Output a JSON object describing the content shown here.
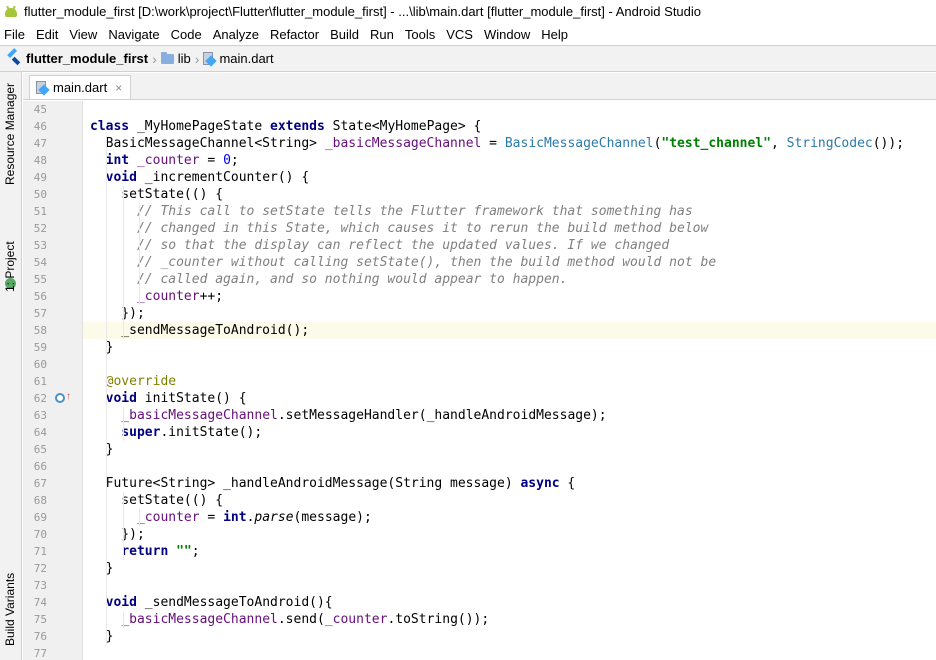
{
  "window": {
    "title": "flutter_module_first [D:\\work\\project\\Flutter\\flutter_module_first] - ...\\lib\\main.dart [flutter_module_first] - Android Studio"
  },
  "menu": [
    "File",
    "Edit",
    "View",
    "Navigate",
    "Code",
    "Analyze",
    "Refactor",
    "Build",
    "Run",
    "Tools",
    "VCS",
    "Window",
    "Help"
  ],
  "breadcrumb": {
    "project": "flutter_module_first",
    "folder": "lib",
    "file": "main.dart"
  },
  "side_tabs": {
    "resource_manager": "Resource Manager",
    "project": "1: Project",
    "build_variants": "Build Variants"
  },
  "editor_tab": {
    "label": "main.dart",
    "close": "×"
  },
  "icons": [
    "android-icon",
    "flutter-icon",
    "folder-icon",
    "dart-file-icon",
    "close-icon",
    "override-icon"
  ],
  "colors": {
    "keyword": "#000080",
    "comment": "#808080",
    "string": "#008000",
    "number": "#0000ff",
    "field": "#660e7a",
    "annotation": "#808000",
    "current_line": "#fcfae8"
  },
  "code": {
    "current_line": 58,
    "lines": [
      {
        "n": "45",
        "text": ""
      },
      {
        "n": "46",
        "text": "class _MyHomePageState extends State<MyHomePage> {"
      },
      {
        "n": "47",
        "text": "  BasicMessageChannel<String> _basicMessageChannel = BasicMessageChannel(\"test_channel\", StringCodec());"
      },
      {
        "n": "48",
        "text": "  int _counter = 0;"
      },
      {
        "n": "49",
        "text": "  void _incrementCounter() {"
      },
      {
        "n": "50",
        "text": "    setState(() {"
      },
      {
        "n": "51",
        "text": "      // This call to setState tells the Flutter framework that something has"
      },
      {
        "n": "52",
        "text": "      // changed in this State, which causes it to rerun the build method below"
      },
      {
        "n": "53",
        "text": "      // so that the display can reflect the updated values. If we changed"
      },
      {
        "n": "54",
        "text": "      // _counter without calling setState(), then the build method would not be"
      },
      {
        "n": "55",
        "text": "      // called again, and so nothing would appear to happen."
      },
      {
        "n": "56",
        "text": "      _counter++;"
      },
      {
        "n": "57",
        "text": "    });"
      },
      {
        "n": "58",
        "text": "    _sendMessageToAndroid();"
      },
      {
        "n": "59",
        "text": "  }"
      },
      {
        "n": "60",
        "text": ""
      },
      {
        "n": "61",
        "text": "  @override"
      },
      {
        "n": "62",
        "text": "  void initState() {"
      },
      {
        "n": "63",
        "text": "    _basicMessageChannel.setMessageHandler(_handleAndroidMessage);"
      },
      {
        "n": "64",
        "text": "    super.initState();"
      },
      {
        "n": "65",
        "text": "  }"
      },
      {
        "n": "66",
        "text": ""
      },
      {
        "n": "67",
        "text": "  Future<String> _handleAndroidMessage(String message) async {"
      },
      {
        "n": "68",
        "text": "    setState(() {"
      },
      {
        "n": "69",
        "text": "      _counter = int.parse(message);"
      },
      {
        "n": "70",
        "text": "    });"
      },
      {
        "n": "71",
        "text": "    return \"\";"
      },
      {
        "n": "72",
        "text": "  }"
      },
      {
        "n": "73",
        "text": ""
      },
      {
        "n": "74",
        "text": "  void _sendMessageToAndroid(){"
      },
      {
        "n": "75",
        "text": "    _basicMessageChannel.send(_counter.toString());"
      },
      {
        "n": "76",
        "text": "  }"
      },
      {
        "n": "77",
        "text": ""
      }
    ]
  }
}
